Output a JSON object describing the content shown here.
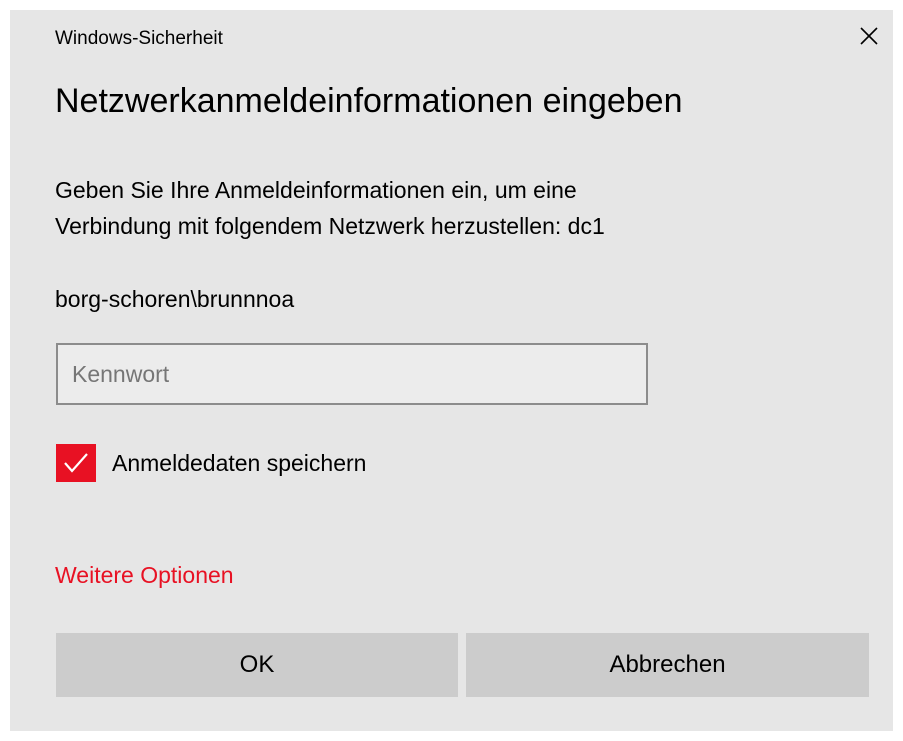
{
  "window": {
    "title": "Windows-Sicherheit",
    "close_icon": "close-icon"
  },
  "dialog": {
    "heading": "Netzwerkanmeldeinformationen eingeben",
    "description_line1": "Geben Sie Ihre Anmeldeinformationen ein, um eine",
    "description_line2": "Verbindung mit folgendem Netzwerk herzustellen: dc1",
    "username": "borg-schoren\\brunnnoa",
    "password": {
      "placeholder": "Kennwort",
      "value": ""
    },
    "remember": {
      "label": "Anmeldedaten speichern",
      "checked": true
    },
    "more_options": "Weitere Optionen",
    "ok_label": "OK",
    "cancel_label": "Abbrechen"
  },
  "colors": {
    "accent": "#e81123",
    "dialog_bg": "#e6e6e6",
    "button_bg": "#cccccc"
  }
}
